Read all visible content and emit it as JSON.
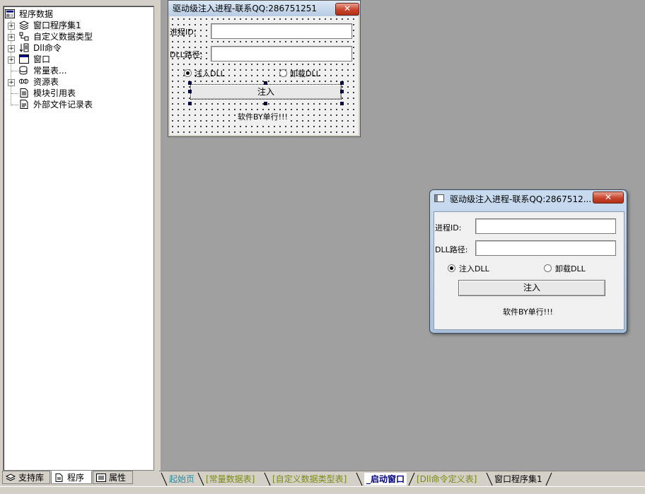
{
  "tree": {
    "root_label": "程序数据",
    "items": [
      {
        "label": "窗口程序集1",
        "expandable": true,
        "icon": "layers-icon"
      },
      {
        "label": "自定义数据类型",
        "expandable": true,
        "icon": "data-type-icon"
      },
      {
        "label": "Dll命令",
        "expandable": true,
        "icon": "dll-command-icon"
      },
      {
        "label": "窗口",
        "expandable": true,
        "icon": "window-icon"
      },
      {
        "label": "常量表...",
        "expandable": false,
        "icon": "database-icon"
      },
      {
        "label": "资源表",
        "expandable": true,
        "icon": "resource-icon"
      },
      {
        "label": "模块引用表",
        "expandable": false,
        "icon": "module-ref-icon"
      },
      {
        "label": "外部文件记录表",
        "expandable": false,
        "icon": "document-icon"
      }
    ]
  },
  "left_tabs": [
    {
      "label": "支持库",
      "icon": "library-icon"
    },
    {
      "label": "程序",
      "icon": "program-icon",
      "active": true
    },
    {
      "label": "属性",
      "icon": "properties-icon"
    }
  ],
  "design_form": {
    "title": "驱动级注入进程-联系QQ:286751251",
    "close": "✕",
    "pid_label": "进程ID:",
    "pid_value": "",
    "dll_label": "DLL路径:",
    "dll_value": "",
    "radio_inject": "注入DLL",
    "radio_unload": "卸载DLL",
    "button": "注入",
    "footer": "软件BY单行!!!"
  },
  "preview_form": {
    "title": "驱动级注入进程-联系QQ:2867512...",
    "close": "✕",
    "pid_label": "进程ID:",
    "pid_value": "",
    "dll_label": "DLL路径:",
    "dll_value": "",
    "radio_inject": "注入DLL",
    "radio_unload": "卸载DLL",
    "button": "注入",
    "footer": "软件BY单行!!!"
  },
  "bottom_tabs": [
    {
      "label": "起始页",
      "color": "#2a8a9a"
    },
    {
      "label": "[常量数据表]",
      "color": "#7a8a10"
    },
    {
      "label": "[自定义数据类型表]",
      "color": "#7a8a10"
    },
    {
      "label": "_启动窗口",
      "color": "#000080",
      "active": true
    },
    {
      "label": "[Dll命令定义表]",
      "color": "#7a8a10"
    },
    {
      "label": "窗口程序集1",
      "color": "#000000"
    }
  ],
  "colors": {
    "design_bg": "#a0a0a0",
    "title_gradient_top": "#dbe8f5",
    "title_gradient_bottom": "#b7cbe3",
    "close_red": "#c8442c"
  }
}
